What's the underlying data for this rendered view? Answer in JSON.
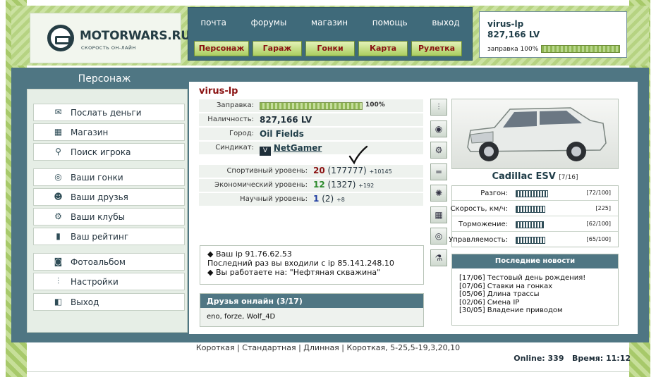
{
  "site": {
    "logo_title": "MOTORWARS.RU",
    "logo_sub": "СКОРОСТЬ ОН-ЛАЙН"
  },
  "top_links": [
    "почта",
    "форумы",
    "магазин",
    "помощь",
    "выход"
  ],
  "nav_buttons": [
    "Персонаж",
    "Гараж",
    "Гонки",
    "Карта",
    "Рулетка"
  ],
  "userbox": {
    "name": "virus-lp",
    "cash": "827,166 LV",
    "fuel_label": "заправка 100%",
    "fuel_level": 1.0
  },
  "left_title": "Персонаж",
  "menu": [
    {
      "label": "Послать деньги",
      "icon": "money-icon"
    },
    {
      "label": "Магазин",
      "icon": "shop-icon"
    },
    {
      "label": "Поиск игрока",
      "icon": "search-icon"
    },
    {
      "label": "Ваши гонки",
      "icon": "steering-wheel-icon"
    },
    {
      "label": "Ваши друзья",
      "icon": "friends-icon"
    },
    {
      "label": "Ваши клубы",
      "icon": "clubs-icon"
    },
    {
      "label": "Ваш рейтинг",
      "icon": "rating-icon"
    },
    {
      "label": "Фотоальбом",
      "icon": "camera-icon"
    },
    {
      "label": "Настройки",
      "icon": "settings-icon"
    },
    {
      "label": "Выход",
      "icon": "exit-icon"
    }
  ],
  "profile": {
    "name": "virus-lp",
    "fuel_label": "Заправка:",
    "fuel_pct": "100%",
    "fuel_level": 1.0,
    "cash_label": "Наличность:",
    "cash": "827,166 LV",
    "city_label": "Город:",
    "city": "Oil Fields",
    "syndicate_label": "Синдикат:",
    "syndicate": "NetGamer",
    "sport_label": "Спортивный уровень:",
    "sport_level": "20",
    "sport_points": "(177777)",
    "sport_delta": "+10145",
    "econ_label": "Экономический уровень:",
    "econ_level": "12",
    "econ_points": "(1327)",
    "econ_delta": "+192",
    "sci_label": "Научный уровень:",
    "sci_level": "1",
    "sci_points": "(2)",
    "sci_delta": "+8"
  },
  "ipinfo": {
    "line1": "Ваш ip 91.76.62.53",
    "line2": "Последний раз вы входили с ip 85.141.248.10",
    "line3": "Вы работаете на: \"Нефтяная скважина\""
  },
  "friends": {
    "title": "Друзья онлайн (3/17)",
    "list": "eno, forze, Wolf_4D"
  },
  "car": {
    "name": "Cadillac ESV",
    "slots": "[7/16]",
    "stats": [
      {
        "label": "Разгон:",
        "value": "[72/100]",
        "level": 0.72
      },
      {
        "label": "Скорость, км/ч:",
        "value": "[225]",
        "level": 0.65
      },
      {
        "label": "Торможение:",
        "value": "[62/100]",
        "level": 0.62
      },
      {
        "label": "Управляемость:",
        "value": "[65/100]",
        "level": 0.65
      }
    ]
  },
  "part_icons": [
    "suspension-icon",
    "tire-icon",
    "brakes-icon",
    "exhaust-icon",
    "wheel-rim-icon",
    "engine-icon",
    "turbo-icon",
    "nitro-icon"
  ],
  "news": {
    "title": "Последние новости",
    "items": [
      "[17/06] Тестовый день рождения!",
      "[07/06] Ставки на гонках",
      "[05/06] Длина трассы",
      "[02/06] Смена IP",
      "[30/05] Владение приводом"
    ]
  },
  "footer": {
    "links": "Короткая | Стандартная | Длинная | Короткая, 5-25,5-19,3,20,10",
    "online": "Online: 339",
    "time": "Время: 11:12"
  }
}
